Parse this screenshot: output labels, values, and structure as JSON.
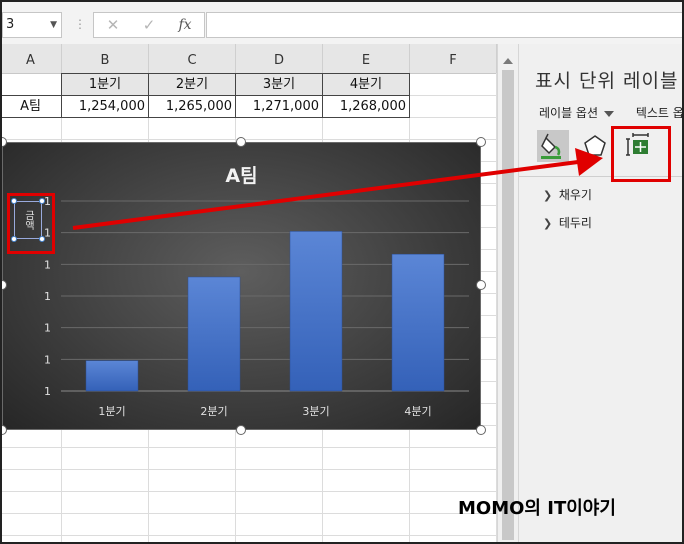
{
  "formula_bar": {
    "name_box": "3",
    "cancel_icon": "✕",
    "enter_icon": "✓",
    "function_icon": "fx",
    "formula": ""
  },
  "sheet": {
    "columns": [
      "A",
      "B",
      "C",
      "D",
      "E",
      "F"
    ],
    "header_row": [
      "1분기",
      "2분기",
      "3분기",
      "4분기"
    ],
    "data_row": {
      "label": "A팀",
      "values": [
        "1,254,000",
        "1,265,000",
        "1,271,000",
        "1,268,000"
      ]
    }
  },
  "chart_data": {
    "type": "bar",
    "title": "A팀",
    "ylabel": "금액",
    "categories": [
      "1분기",
      "2분기",
      "3분기",
      "4분기"
    ],
    "series": [
      {
        "values": [
          1254000,
          1265000,
          1271000,
          1268000
        ]
      }
    ],
    "ylim": [
      1250000,
      1275000
    ],
    "ytick_labels": [
      "1",
      "1",
      "1",
      "1",
      "1",
      "1",
      "1"
    ],
    "grid": true,
    "bar_color": "#4472c4"
  },
  "pane": {
    "title": "표시 단위 레이블 서식",
    "tab_options": "레이블 옵션",
    "tab_text": "텍스트 옵션",
    "icons": [
      "fill-line-icon",
      "effects-icon",
      "size-properties-icon"
    ],
    "sections": [
      {
        "label": "채우기"
      },
      {
        "label": "테두리"
      }
    ]
  },
  "annotation_color": "#e00000",
  "watermark": "MOMO의 IT이야기"
}
